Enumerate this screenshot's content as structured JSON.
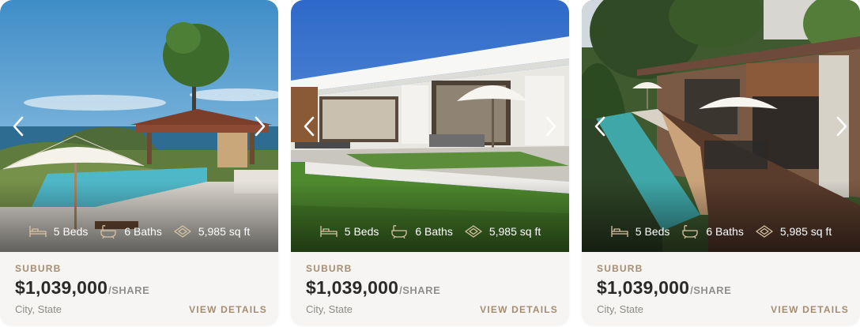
{
  "colors": {
    "accent": "#a48d70",
    "card_background": "#f6f5f3",
    "price_text": "#2a2a2a",
    "secondary_text": "#8e8a85"
  },
  "icons": {
    "prev": "chevron-left-icon",
    "next": "chevron-right-icon",
    "beds": "bed-icon",
    "baths": "bathtub-icon",
    "area": "area-icon"
  },
  "listings": [
    {
      "photo": "villa-with-infinity-pool-and-ocean-view",
      "beds": "5 Beds",
      "baths": "6 Baths",
      "area": "5,985 sq ft",
      "suburb": "SUBURB",
      "price": "$1,039,000",
      "price_suffix": "/SHARE",
      "location": "City, State",
      "cta": "VIEW DETAILS"
    },
    {
      "photo": "modern-white-villa-with-lawn",
      "beds": "5 Beds",
      "baths": "6 Baths",
      "area": "5,985 sq ft",
      "suburb": "SUBURB",
      "price": "$1,039,000",
      "price_suffix": "/SHARE",
      "location": "City, State",
      "cta": "VIEW DETAILS"
    },
    {
      "photo": "hillside-villa-with-lap-pool",
      "beds": "5 Beds",
      "baths": "6 Baths",
      "area": "5,985 sq ft",
      "suburb": "SUBURB",
      "price": "$1,039,000",
      "price_suffix": "/SHARE",
      "location": "City, State",
      "cta": "VIEW DETAILS"
    }
  ]
}
